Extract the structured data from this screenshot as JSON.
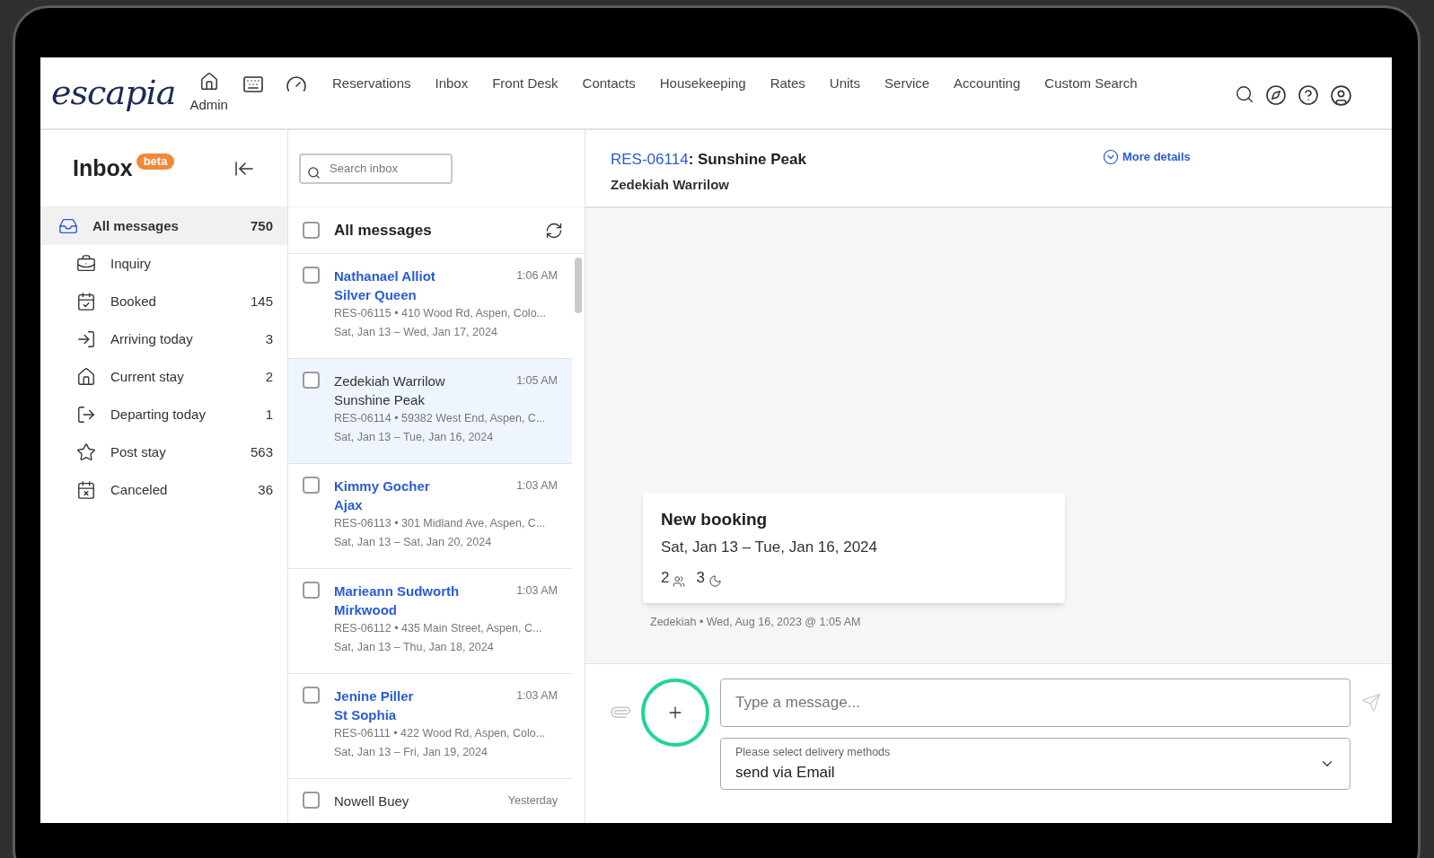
{
  "nav": {
    "logo": "escapia",
    "admin_label": "Admin",
    "links": [
      "Reservations",
      "Inbox",
      "Front Desk",
      "Contacts",
      "Housekeeping",
      "Rates",
      "Units",
      "Service",
      "Accounting",
      "Custom Search"
    ]
  },
  "sidebar": {
    "title": "Inbox",
    "badge": "beta",
    "items": [
      {
        "label": "All messages",
        "count": "750",
        "selected": true
      },
      {
        "label": "Inquiry",
        "selected": false
      },
      {
        "label": "Booked",
        "count": "145",
        "selected": false
      },
      {
        "label": "Arriving today",
        "count": "3",
        "selected": false
      },
      {
        "label": "Current stay",
        "count": "2",
        "selected": false
      },
      {
        "label": "Departing today",
        "count": "1",
        "selected": false
      },
      {
        "label": "Post stay",
        "count": "563",
        "selected": false
      },
      {
        "label": "Canceled",
        "count": "36",
        "selected": false
      }
    ]
  },
  "message_list": {
    "search": {
      "placeholder": "Search inbox"
    },
    "header": "All messages",
    "header_checked": false,
    "rows": [
      {
        "name": "Nathanael Alliot",
        "property": "Silver Queen",
        "details": "RES-06115 • 410 Wood Rd, Aspen, Colo...",
        "dates": "Sat, Jan 13 – Wed, Jan 17, 2024",
        "time": "1:06 AM",
        "unread": true,
        "selected": false,
        "checked": false
      },
      {
        "name": "Zedekiah Warrilow",
        "property": "Sunshine Peak",
        "details": "RES-06114 • 59382 West End, Aspen, C...",
        "dates": "Sat, Jan 13 – Tue, Jan 16, 2024",
        "time": "1:05 AM",
        "unread": false,
        "selected": true,
        "checked": false
      },
      {
        "name": "Kimmy Gocher",
        "property": "Ajax",
        "details": "RES-06113 • 301 Midland Ave, Aspen, C...",
        "dates": "Sat, Jan 13 – Sat, Jan 20, 2024",
        "time": "1:03 AM",
        "unread": true,
        "selected": false,
        "checked": false
      },
      {
        "name": "Marieann Sudworth",
        "property": "Mirkwood",
        "details": "RES-06112 • 435 Main Street, Aspen, C...",
        "dates": "Sat, Jan 13 – Thu, Jan 18, 2024",
        "time": "1:03 AM",
        "unread": true,
        "selected": false,
        "checked": false
      },
      {
        "name": "Jenine Piller",
        "property": "St Sophia",
        "details": "RES-06111 • 422 Wood Rd, Aspen, Colo...",
        "dates": "Sat, Jan 13 – Fri, Jan 19, 2024",
        "time": "1:03 AM",
        "unread": true,
        "selected": false,
        "checked": false
      },
      {
        "name": "Nowell Buey",
        "time": "Yesterday",
        "unread": false,
        "selected": false,
        "checked": false
      }
    ]
  },
  "conversation": {
    "reservation_id": "RES-06114",
    "property": ": Sunshine Peak",
    "guest": "Zedekiah Warrilow",
    "more_details": "More details",
    "message": {
      "title": "New booking",
      "dates": "Sat, Jan 13 – Tue, Jan 16, 2024",
      "guests": "2",
      "nights": "3",
      "author": "Zedekiah",
      "separator": "•",
      "timestamp": "Wed, Aug 16, 2023 @ 1:05 AM"
    },
    "composer": {
      "placeholder": "Type a message...",
      "delivery_label": "Please select delivery methods",
      "delivery_value": "send via Email"
    }
  }
}
